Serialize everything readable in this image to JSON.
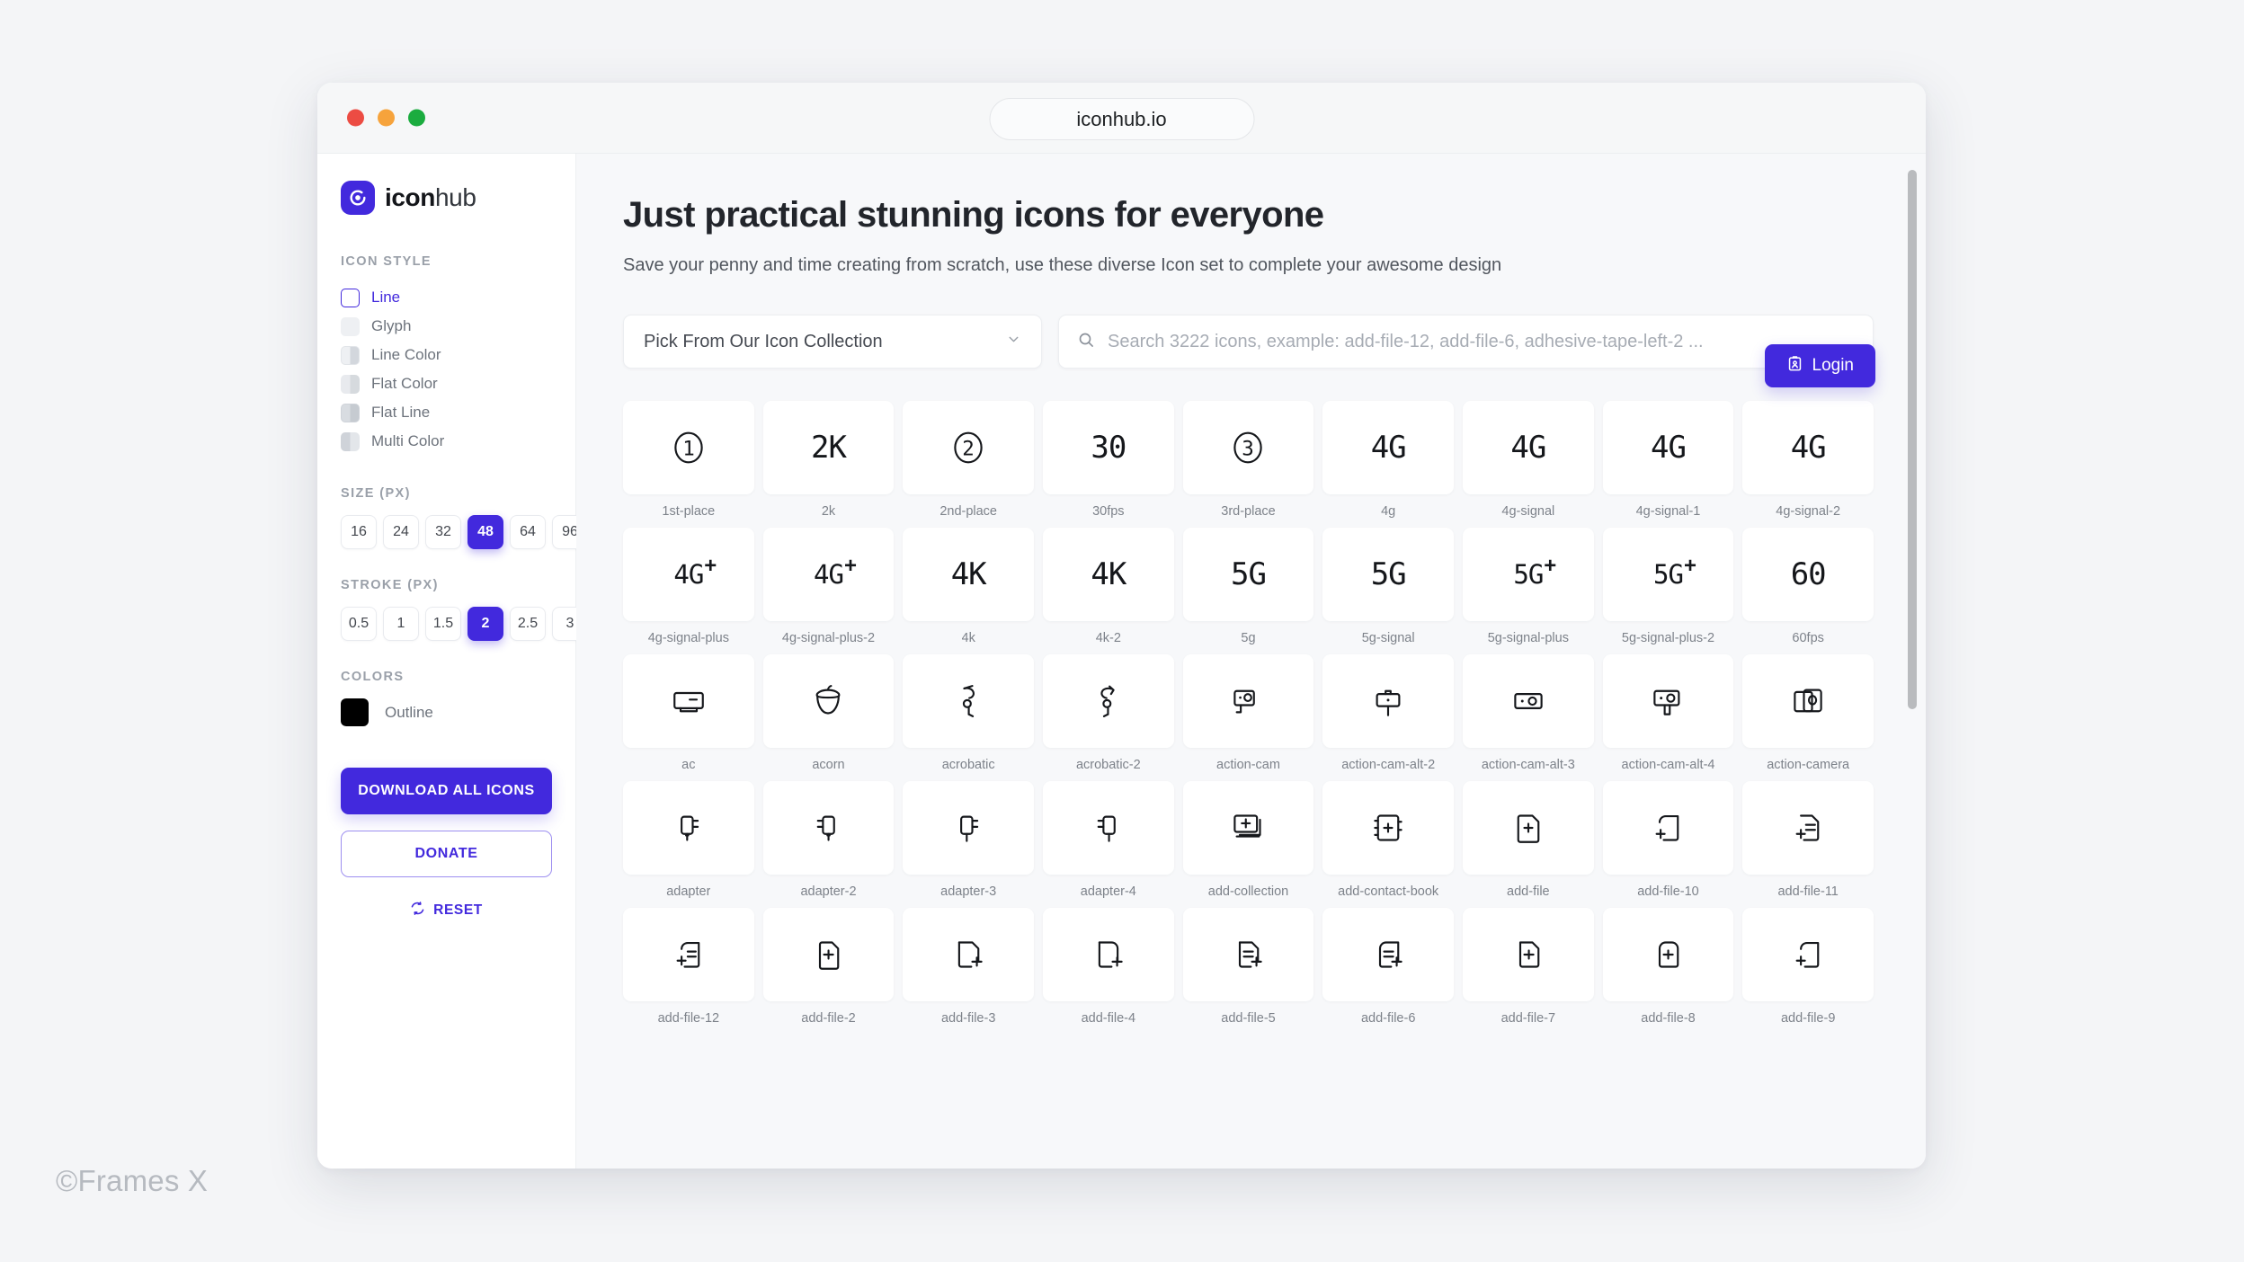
{
  "watermark": "©Frames X",
  "browser": {
    "url": "iconhub.io"
  },
  "sidebar": {
    "brand": {
      "bold": "icon",
      "light": "hub"
    },
    "icon_style": {
      "title": "ICON STYLE",
      "items": [
        {
          "label": "Line",
          "swatch": "line",
          "active": true
        },
        {
          "label": "Glyph",
          "swatch": "glyph",
          "active": false
        },
        {
          "label": "Line Color",
          "swatch": "linecolor",
          "active": false
        },
        {
          "label": "Flat Color",
          "swatch": "flatcolor",
          "active": false
        },
        {
          "label": "Flat Line",
          "swatch": "flatline",
          "active": false
        },
        {
          "label": "Multi Color",
          "swatch": "multicolor",
          "active": false
        }
      ]
    },
    "size": {
      "title": "SIZE (PX)",
      "options": [
        "16",
        "24",
        "32",
        "48",
        "64",
        "96"
      ],
      "selected": "48"
    },
    "stroke": {
      "title": "STROKE (PX)",
      "options": [
        "0.5",
        "1",
        "1.5",
        "2",
        "2.5",
        "3"
      ],
      "selected": "2"
    },
    "colors": {
      "title": "COLORS",
      "swatch_hex": "#000000",
      "label": "Outline"
    },
    "download_label": "DOWNLOAD ALL ICONS",
    "donate_label": "DONATE",
    "reset_label": "RESET"
  },
  "main": {
    "login_label": "Login",
    "title": "Just practical stunning icons for everyone",
    "subtitle": "Save your penny and time creating from scratch, use these diverse Icon set to complete your awesome design",
    "collection_select": "Pick From Our Icon Collection",
    "search_placeholder": "Search 3222 icons, example: add-file-12, add-file-6, adhesive-tape-left-2 ...",
    "icons": [
      {
        "name": "1st-place",
        "kind": "circle-num",
        "text": "1"
      },
      {
        "name": "2k",
        "kind": "text",
        "text": "2K"
      },
      {
        "name": "2nd-place",
        "kind": "circle-num",
        "text": "2"
      },
      {
        "name": "30fps",
        "kind": "text",
        "text": "30"
      },
      {
        "name": "3rd-place",
        "kind": "circle-num",
        "text": "3"
      },
      {
        "name": "4g",
        "kind": "text",
        "text": "4G"
      },
      {
        "name": "4g-signal",
        "kind": "text",
        "text": "4G"
      },
      {
        "name": "4g-signal-1",
        "kind": "text",
        "text": "4G"
      },
      {
        "name": "4g-signal-2",
        "kind": "text",
        "text": "4G"
      },
      {
        "name": "4g-signal-plus",
        "kind": "text-plus",
        "text": "4G"
      },
      {
        "name": "4g-signal-plus-2",
        "kind": "text-plus",
        "text": "4G"
      },
      {
        "name": "4k",
        "kind": "text",
        "text": "4K"
      },
      {
        "name": "4k-2",
        "kind": "text",
        "text": "4K"
      },
      {
        "name": "5g",
        "kind": "text",
        "text": "5G"
      },
      {
        "name": "5g-signal",
        "kind": "text",
        "text": "5G"
      },
      {
        "name": "5g-signal-plus",
        "kind": "text-plus",
        "text": "5G"
      },
      {
        "name": "5g-signal-plus-2",
        "kind": "text-plus",
        "text": "5G"
      },
      {
        "name": "60fps",
        "kind": "text",
        "text": "60"
      },
      {
        "name": "ac",
        "kind": "ac"
      },
      {
        "name": "acorn",
        "kind": "acorn"
      },
      {
        "name": "acrobatic",
        "kind": "acrobatic"
      },
      {
        "name": "acrobatic-2",
        "kind": "acrobatic2"
      },
      {
        "name": "action-cam",
        "kind": "action-cam"
      },
      {
        "name": "action-cam-alt-2",
        "kind": "action-cam-alt-2"
      },
      {
        "name": "action-cam-alt-3",
        "kind": "action-cam-alt-3"
      },
      {
        "name": "action-cam-alt-4",
        "kind": "action-cam-alt-4"
      },
      {
        "name": "action-camera",
        "kind": "action-camera"
      },
      {
        "name": "adapter",
        "kind": "adapter"
      },
      {
        "name": "adapter-2",
        "kind": "adapter2"
      },
      {
        "name": "adapter-3",
        "kind": "adapter3"
      },
      {
        "name": "adapter-4",
        "kind": "adapter4"
      },
      {
        "name": "add-collection",
        "kind": "add-collection"
      },
      {
        "name": "add-contact-book",
        "kind": "add-contact-book"
      },
      {
        "name": "add-file",
        "kind": "add-file"
      },
      {
        "name": "add-file-10",
        "kind": "add-file-10"
      },
      {
        "name": "add-file-11",
        "kind": "add-file-11"
      },
      {
        "name": "add-file-12",
        "kind": "add-file-12"
      },
      {
        "name": "add-file-2",
        "kind": "add-file-2"
      },
      {
        "name": "add-file-3",
        "kind": "add-file-3"
      },
      {
        "name": "add-file-4",
        "kind": "add-file-4"
      },
      {
        "name": "add-file-5",
        "kind": "add-file-5"
      },
      {
        "name": "add-file-6",
        "kind": "add-file-6"
      },
      {
        "name": "add-file-7",
        "kind": "add-file-7"
      },
      {
        "name": "add-file-8",
        "kind": "add-file-8"
      },
      {
        "name": "add-file-9",
        "kind": "add-file-9"
      }
    ]
  },
  "theme": {
    "accent": "#4229DD",
    "page_bg": "#F4F5F7",
    "main_bg": "#F7F8FA",
    "tile_bg": "#FFFFFF"
  }
}
